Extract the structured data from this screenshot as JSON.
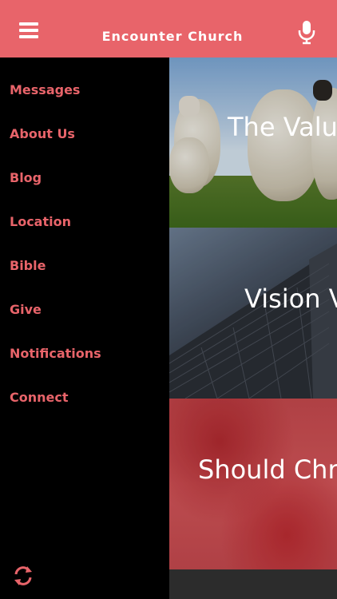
{
  "header": {
    "title": "Encounter Church",
    "background": "#e8646a",
    "menu_icon": "hamburger-menu-icon",
    "mic_icon": "microphone-icon"
  },
  "drawer": {
    "accent_color": "#e8646a",
    "items": [
      {
        "label": "Messages"
      },
      {
        "label": "About Us"
      },
      {
        "label": "Blog"
      },
      {
        "label": "Location"
      },
      {
        "label": "Bible"
      },
      {
        "label": "Give"
      },
      {
        "label": "Notifications"
      },
      {
        "label": "Connect"
      }
    ],
    "refresh_icon": "refresh-icon"
  },
  "cards": [
    {
      "title": "The Value"
    },
    {
      "title": "Vision V"
    },
    {
      "title": "Should Chris"
    }
  ]
}
